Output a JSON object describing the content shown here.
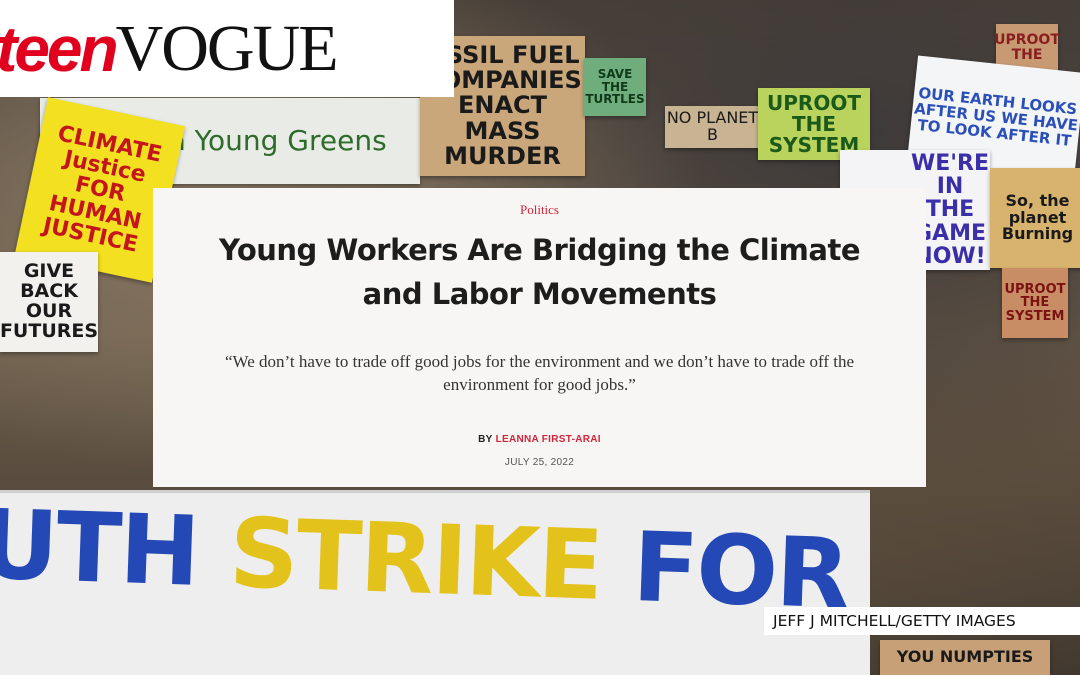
{
  "brand": {
    "teen": "teen",
    "vogue": "VOGUE",
    "teen_color": "#e1001e"
  },
  "article": {
    "category": "Politics",
    "title": "Young Workers Are Bridging the Climate and Labor Movements",
    "dek": "“We don’t have to trade off good jobs for the environment and we don’t have to trade off the environment for good jobs.”",
    "byline_prefix": "BY",
    "author": "LEANNA FIRST-ARAI",
    "date": "JULY 25, 2022",
    "accent_color": "#d1253b"
  },
  "photo": {
    "credit": "JEFF J MITCHELL/GETTY IMAGES",
    "signs": {
      "fossil": "OSSIL FUEL COMPANIES ENACT MASS MURDER",
      "scottish": "Scottish Young Greens",
      "climate_justice": "CLIMATE Justice FOR HUMAN JUSTICE",
      "give_back": "GIVE BACK OUR FUTURES",
      "no_planet": "NO PLANET B",
      "uproot_system": "UPROOT THE SYSTEM",
      "uproot_the": "UPROOT THE",
      "our_earth": "OUR EARTH LOOKS AFTER US WE HAVE TO LOOK AFTER IT",
      "were_in_game": "WE'RE IN THE GAME NOW!",
      "so_planet": "So, the planet Burning",
      "uproot_small": "UPROOT THE SYSTEM",
      "save_turtles": "SAVE THE TURTLES",
      "numpties": "YOU NUMPTIES",
      "banner": "UTH STRIKE FOR CLIMATE !"
    }
  }
}
